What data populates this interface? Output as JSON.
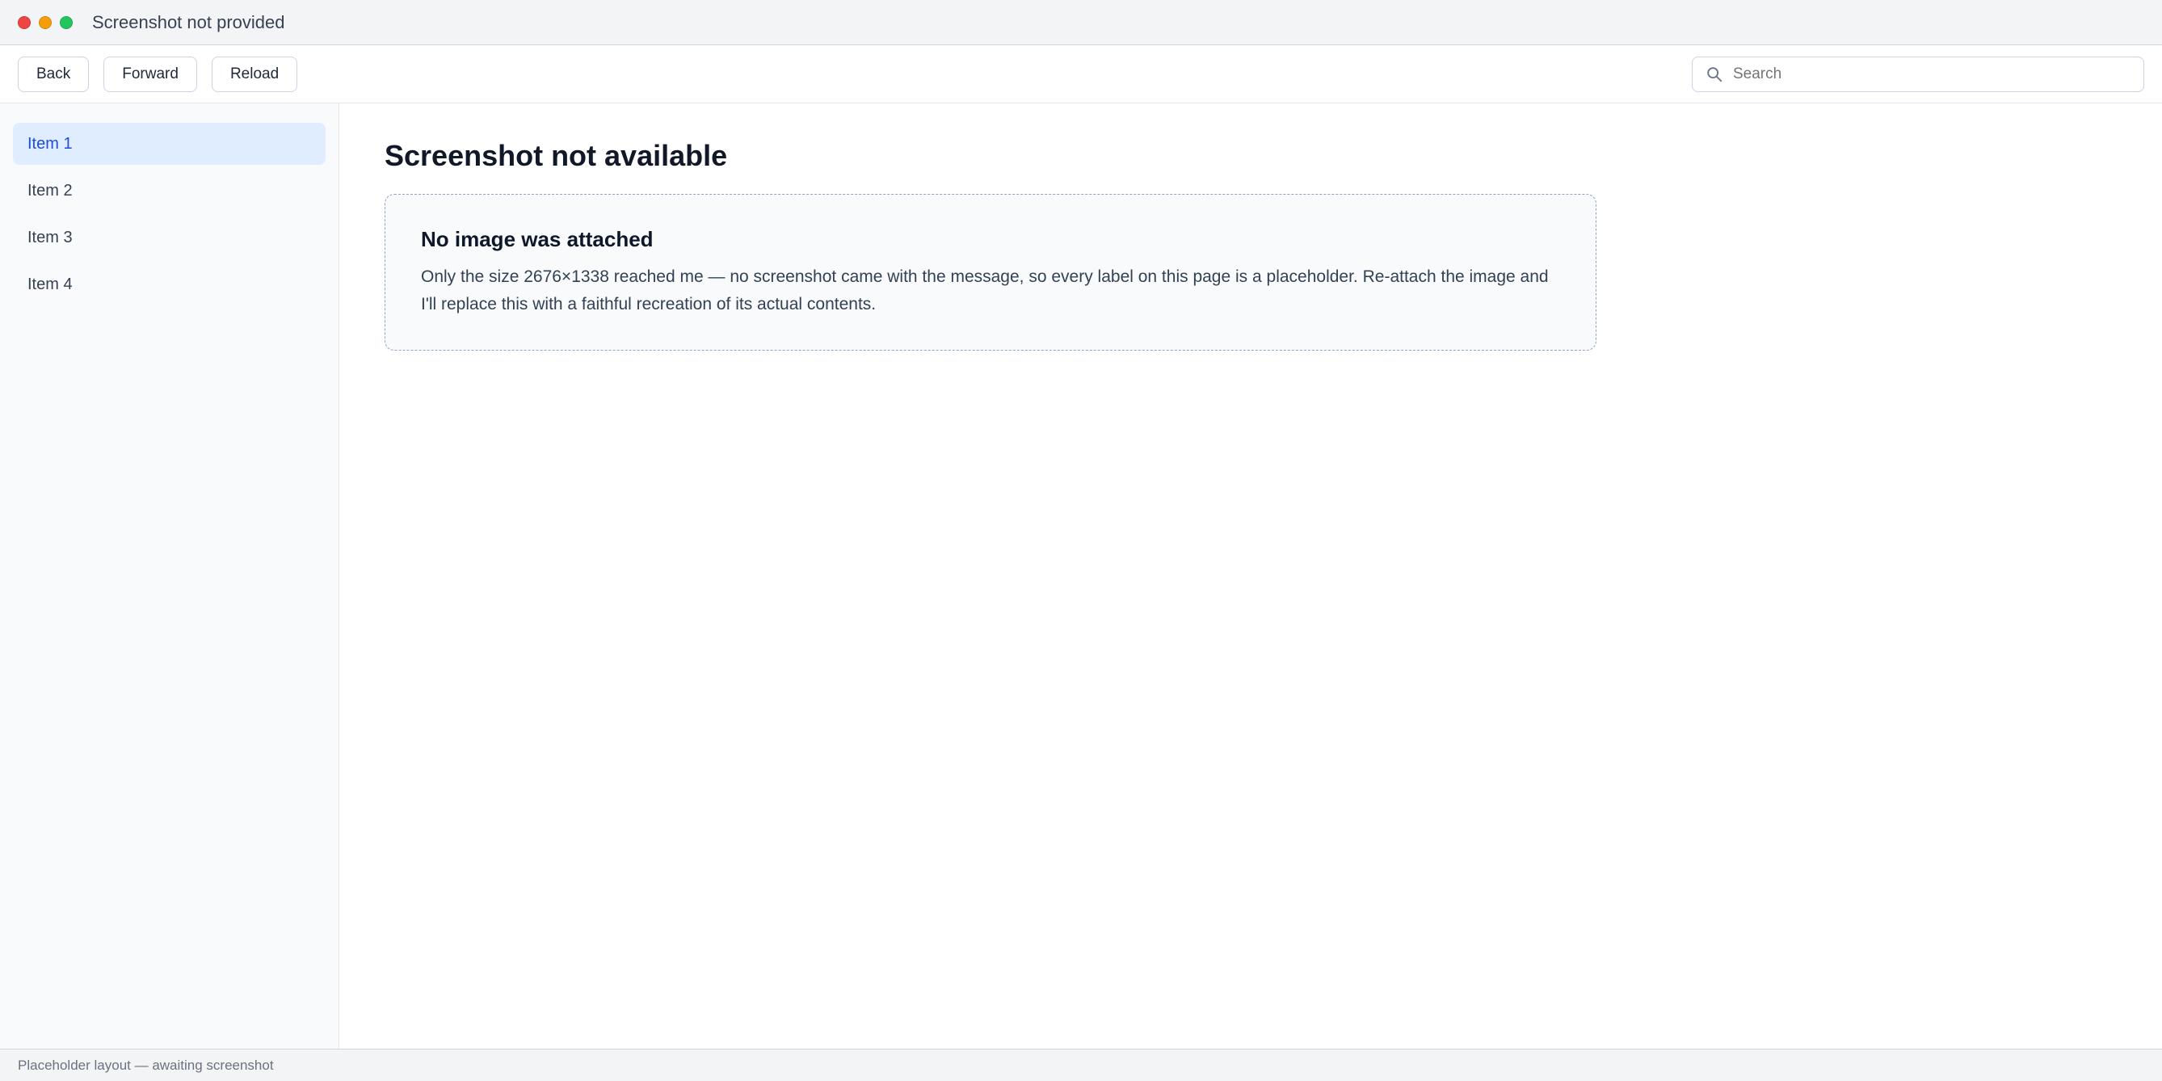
{
  "window": {
    "title": "Screenshot not provided"
  },
  "toolbar": {
    "buttons": [
      {
        "label": "Back"
      },
      {
        "label": "Forward"
      },
      {
        "label": "Reload"
      }
    ],
    "search_placeholder": "Search"
  },
  "sidebar": {
    "items": [
      {
        "label": "Item 1"
      },
      {
        "label": "Item 2"
      },
      {
        "label": "Item 3"
      },
      {
        "label": "Item 4"
      }
    ]
  },
  "main": {
    "heading": "Screenshot not available",
    "notice_title": "No image was attached",
    "notice_body": "Only the size 2676×1338 reached me — no screenshot came with the message, so every label on this page is a placeholder. Re-attach the image and I'll replace this with a faithful recreation of its actual contents."
  },
  "status": {
    "text": "Placeholder layout — awaiting screenshot"
  },
  "colors": {
    "close": "#ef4444",
    "minimize": "#f59e0b",
    "maximize": "#22c55e"
  }
}
